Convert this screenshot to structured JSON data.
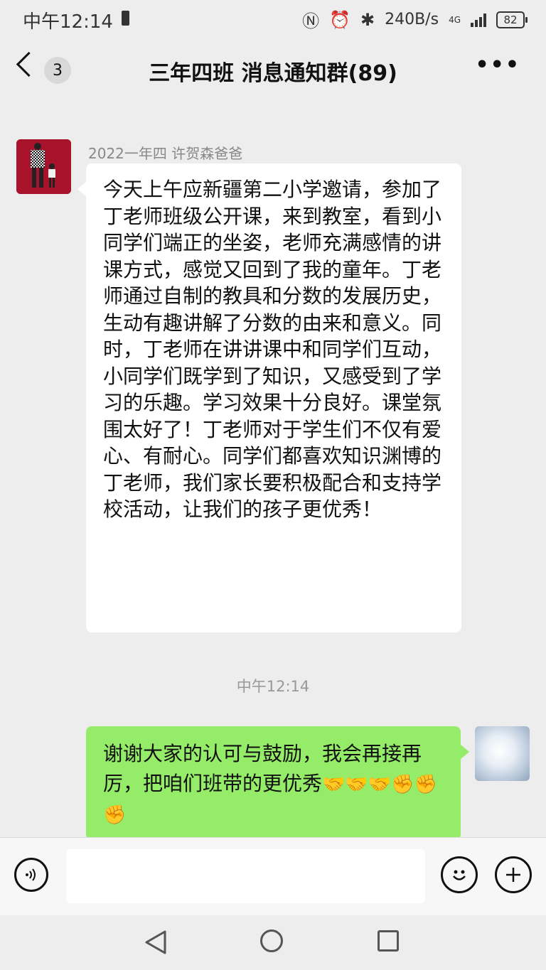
{
  "status_bar": {
    "time": "中午12:14",
    "net_speed": "240B/s",
    "network_type": "4G",
    "battery_level": "82",
    "icons": [
      "nfc-icon",
      "alarm-icon",
      "bluetooth-icon",
      "signal-icon",
      "battery-icon"
    ]
  },
  "header": {
    "unread_badge": "3",
    "title": "三年四班 消息通知群(89)",
    "more_label": "•••"
  },
  "messages": [
    {
      "sender": "2022一年四 许贺森爸爸",
      "text": "今天上午应新疆第二小学邀请，参加了丁老师班级公开课，来到教室，看到小同学们端正的坐姿，老师充满感情的讲课方式，感觉又回到了我的童年。丁老师通过自制的教具和分数的发展历史，生动有趣讲解了分数的由来和意义。同时，丁老师在讲讲课中和同学们互动，小同学们既学到了知识，又感受到了学习的乐趣。学习效果十分良好。课堂氛围太好了！丁老师对于学生们不仅有爱心、有耐心。同学们都喜欢知识渊博的丁老师，我们家长要积极配合和支持学校活动，让我们的孩子更优秀！"
    },
    {
      "timestamp": "中午12:14"
    },
    {
      "text": "谢谢大家的认可与鼓励，我会再接再厉，把咱们班带的更优秀",
      "emojis": "🤝🤝🤝✊✊✊"
    }
  ],
  "input_bar": {
    "placeholder": "",
    "voice_icon": "voice-icon",
    "emoji_icon": "emoji-icon",
    "plus_icon": "plus-icon"
  },
  "nav_bar": {
    "icons": [
      "nav-back-icon",
      "nav-home-icon",
      "nav-recent-icon"
    ]
  },
  "colors": {
    "background": "#ededed",
    "sent_bubble": "#95ec69",
    "received_bubble": "#ffffff"
  }
}
